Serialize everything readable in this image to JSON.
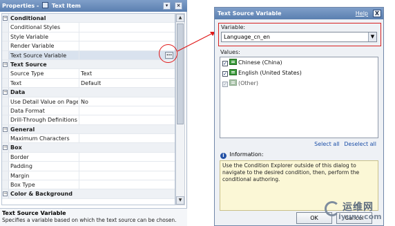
{
  "properties_panel": {
    "title": "Properties - ",
    "selection_label": "Text Item",
    "rows": [
      {
        "type": "category",
        "label": "Conditional",
        "value": ""
      },
      {
        "type": "prop",
        "label": "Conditional Styles",
        "value": ""
      },
      {
        "type": "prop",
        "label": "Style Variable",
        "value": ""
      },
      {
        "type": "prop",
        "label": "Render Variable",
        "value": ""
      },
      {
        "type": "prop",
        "label": "Text Source Variable",
        "value": "",
        "selected": true,
        "has_ellipsis": true
      },
      {
        "type": "category",
        "label": "Text Source",
        "value": ""
      },
      {
        "type": "prop",
        "label": "Source Type",
        "value": "Text"
      },
      {
        "type": "prop",
        "label": "Text",
        "value": "Default"
      },
      {
        "type": "category",
        "label": "Data",
        "value": ""
      },
      {
        "type": "prop",
        "label": "Use Detail Value on Page",
        "value": "No"
      },
      {
        "type": "prop",
        "label": "Data Format",
        "value": ""
      },
      {
        "type": "prop",
        "label": "Drill-Through Definitions",
        "value": ""
      },
      {
        "type": "category",
        "label": "General",
        "value": ""
      },
      {
        "type": "prop",
        "label": "Maximum Characters",
        "value": ""
      },
      {
        "type": "category",
        "label": "Box",
        "value": ""
      },
      {
        "type": "prop",
        "label": "Border",
        "value": ""
      },
      {
        "type": "prop",
        "label": "Padding",
        "value": ""
      },
      {
        "type": "prop",
        "label": "Margin",
        "value": ""
      },
      {
        "type": "prop",
        "label": "Box Type",
        "value": ""
      },
      {
        "type": "category",
        "label": "Color & Background",
        "value": ""
      }
    ],
    "ellipsis_label": "...",
    "description_title": "Text Source Variable",
    "description_text": "Specifies a variable based on which the text source can be chosen."
  },
  "dialog": {
    "title": "Text Source Variable",
    "help_label": "Help",
    "close_label": "X",
    "variable_label": "Variable:",
    "variable_value": "Language_cn_en",
    "values_label": "Values:",
    "values": [
      {
        "label": "Chinese (China)",
        "checked": true,
        "dim": false
      },
      {
        "label": "English (United States)",
        "checked": true,
        "dim": false
      },
      {
        "label": "(Other)",
        "checked": true,
        "dim": true
      }
    ],
    "select_all_label": "Select all",
    "deselect_all_label": "Deselect all",
    "information_label": "Information:",
    "information_lines": [
      "Use the Condition Explorer outside of this dialog to",
      "navigate to the desired condition, then, perform the",
      "conditional authoring."
    ],
    "ok_label": "OK",
    "cancel_label": "Cancel"
  },
  "watermark": {
    "line1": "运维网",
    "line2": "iyunv.com"
  },
  "colors": {
    "title_bar": "#5b7fb0",
    "callout_red": "#e01818",
    "info_bg": "#fbf7d6",
    "link": "#1b4fa8"
  },
  "icons": {
    "expand": "minus-box-icon",
    "value_item": "green-list-icon",
    "info": "info-icon",
    "dropdown": "chevron-down-icon"
  }
}
